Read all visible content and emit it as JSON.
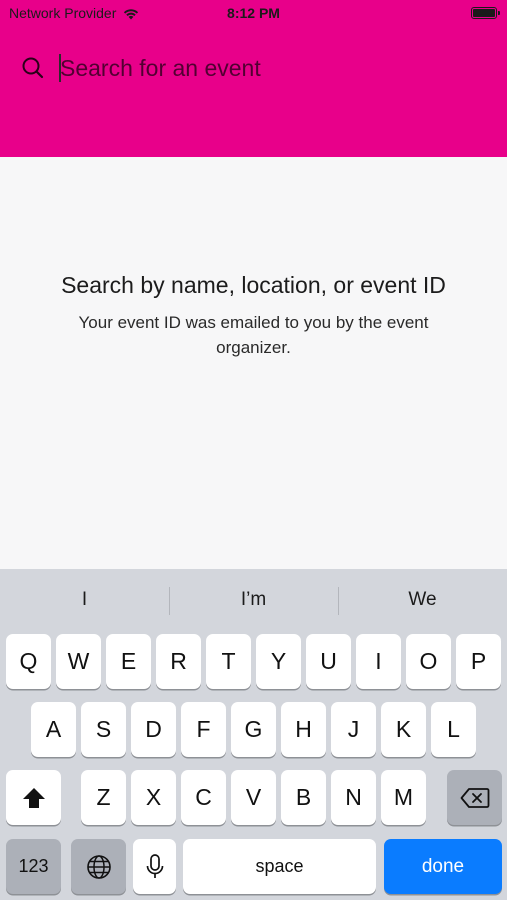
{
  "status_bar": {
    "carrier": "Network Provider",
    "time": "8:12 PM",
    "wifi_icon": "wifi-icon",
    "battery_icon": "battery-icon"
  },
  "search": {
    "placeholder": "Search for an event",
    "value": "",
    "icon": "search-icon"
  },
  "empty_state": {
    "title": "Search by name, location, or event ID",
    "subtitle": "Your event ID was emailed to you by the event organizer."
  },
  "keyboard": {
    "suggestions": [
      "I",
      "I’m",
      "We"
    ],
    "row1": [
      "Q",
      "W",
      "E",
      "R",
      "T",
      "Y",
      "U",
      "I",
      "O",
      "P"
    ],
    "row2": [
      "A",
      "S",
      "D",
      "F",
      "G",
      "H",
      "J",
      "K",
      "L"
    ],
    "row3": [
      "Z",
      "X",
      "C",
      "V",
      "B",
      "N",
      "M"
    ],
    "numbers_key": "123",
    "space_key": "space",
    "done_key": "done"
  },
  "colors": {
    "header": "#e8008a",
    "done_key": "#0a7cff"
  }
}
